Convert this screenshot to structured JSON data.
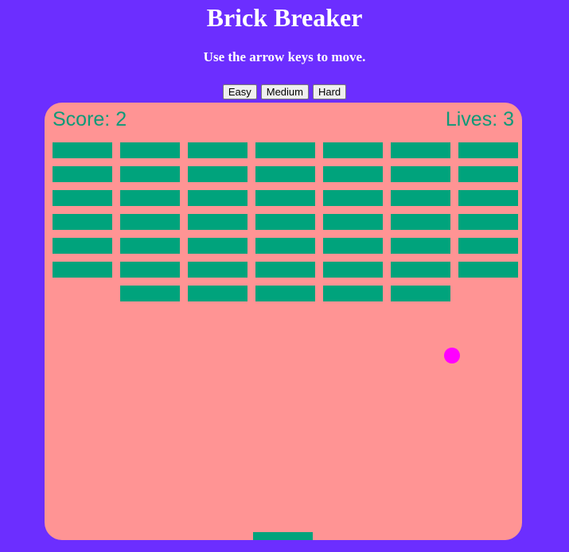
{
  "header": {
    "title": "Brick Breaker",
    "instructions": "Use the arrow keys to move."
  },
  "difficulty": {
    "easy_label": "Easy",
    "medium_label": "Medium",
    "hard_label": "Hard"
  },
  "game": {
    "score_text": "Score: 2",
    "lives_text": "Lives: 3",
    "brick_grid": {
      "columns": 7,
      "rows": 7,
      "missing_bricks": [
        [
          6,
          0
        ],
        [
          6,
          6
        ]
      ]
    },
    "colors": {
      "page_background": "#6c2eff",
      "board_background": "#ff9494",
      "brick": "#00a37c",
      "ball": "#ff00ff",
      "paddle": "#00a37c",
      "hud_text": "#0d9a78"
    }
  }
}
